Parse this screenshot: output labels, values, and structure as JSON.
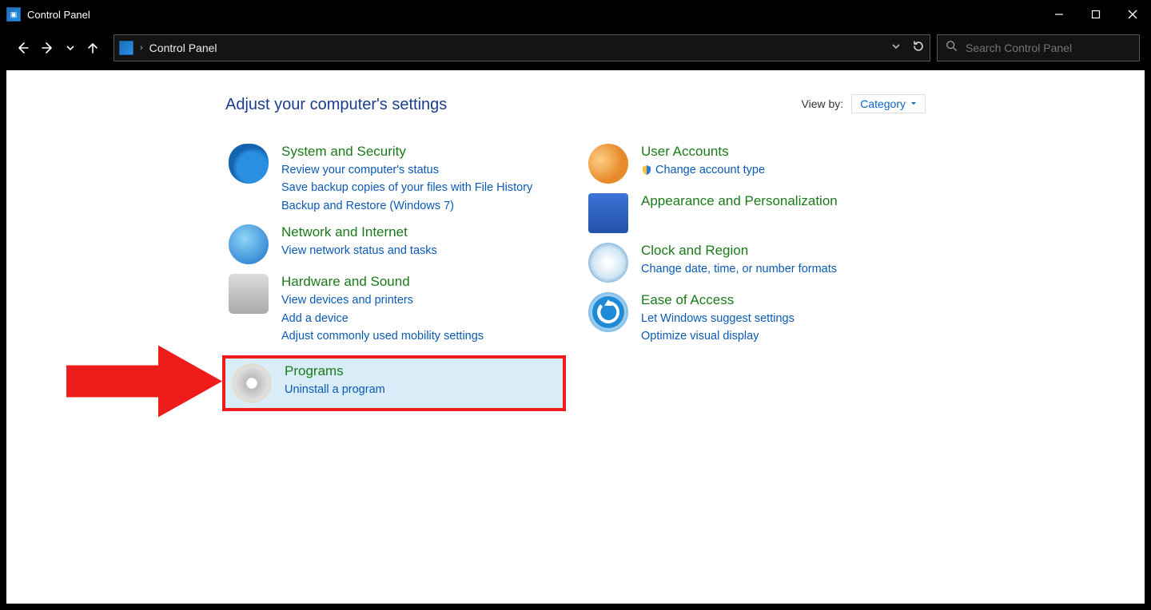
{
  "window": {
    "title": "Control Panel"
  },
  "address": {
    "breadcrumb": "Control Panel"
  },
  "search": {
    "placeholder": "Search Control Panel"
  },
  "heading": "Adjust your computer's settings",
  "viewby": {
    "label": "View by:",
    "value": "Category"
  },
  "left": {
    "system": {
      "title": "System and Security",
      "l1": "Review your computer's status",
      "l2": "Save backup copies of your files with File History",
      "l3": "Backup and Restore (Windows 7)"
    },
    "network": {
      "title": "Network and Internet",
      "l1": "View network status and tasks"
    },
    "hardware": {
      "title": "Hardware and Sound",
      "l1": "View devices and printers",
      "l2": "Add a device",
      "l3": "Adjust commonly used mobility settings"
    },
    "programs": {
      "title": "Programs",
      "l1": "Uninstall a program"
    }
  },
  "right": {
    "users": {
      "title": "User Accounts",
      "l1": "Change account type"
    },
    "appearance": {
      "title": "Appearance and Personalization"
    },
    "clock": {
      "title": "Clock and Region",
      "l1": "Change date, time, or number formats"
    },
    "ease": {
      "title": "Ease of Access",
      "l1": "Let Windows suggest settings",
      "l2": "Optimize visual display"
    }
  }
}
